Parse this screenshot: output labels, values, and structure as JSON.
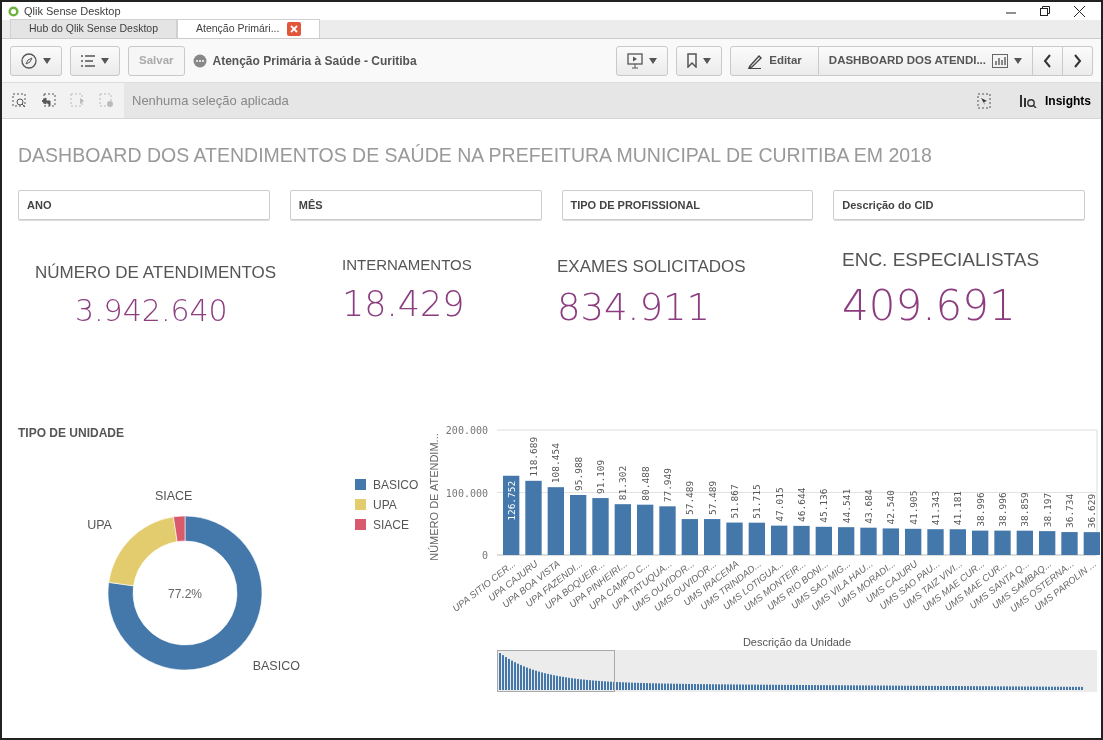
{
  "window": {
    "title": "Qlik Sense Desktop"
  },
  "tabs": [
    {
      "label": "Hub do Qlik Sense Desktop",
      "selected": false,
      "closable": false
    },
    {
      "label": "Atenção Primári...",
      "selected": true,
      "closable": true
    }
  ],
  "toolbar": {
    "save_label": "Salvar",
    "save_disabled": true,
    "app_title": "Atenção Primária à Saúde - Curitiba",
    "edit_label": "Editar",
    "sheet_label": "DASHBOARD DOS ATENDI..."
  },
  "selection_bar": {
    "message": "Nenhuma seleção aplicada",
    "insights_label": "Insights"
  },
  "dashboard": {
    "title": "DASHBOARD DOS ATENDIMENTOS DE SAÚDE NA PREFEITURA MUNICIPAL DE CURITIBA EM 2018",
    "filters": [
      "ANO",
      "MÊS",
      "TIPO DE PROFISSIONAL",
      "Descrição do CID"
    ],
    "kpis": [
      {
        "label": "NÚMERO DE ATENDIMENTOS",
        "value": "3.942.640"
      },
      {
        "label": "INTERNAMENTOS",
        "value": "18.429"
      },
      {
        "label": "EXAMES SOLICITADOS",
        "value": "834.911"
      },
      {
        "label": "ENC. ESPECIALISTAS",
        "value": "409.691"
      }
    ]
  },
  "donut": {
    "center_label": "77.2%",
    "chart_data": {
      "type": "donut",
      "title": "TIPO DE UNIDADE",
      "categories": [
        "BASICO",
        "UPA",
        "SIACE"
      ],
      "legend": "right",
      "series": [
        {
          "colors": [
            "#4477aa",
            "#e3cc6e",
            "#d9596d"
          ],
          "values": [
            77.2,
            20.4,
            2.4
          ]
        }
      ]
    }
  },
  "bar_chart": {
    "chart_data": {
      "type": "bar",
      "ylabel": "NÚMERO DE ATENDIM...",
      "xlabel": "Descrição da Unidade",
      "ylim": [
        0,
        200
      ],
      "yticks": [
        0,
        {
          "value": 100,
          "label": "100.000"
        },
        {
          "value": 200,
          "label": "200.000"
        }
      ],
      "value_labels": [
        "126.752",
        "118.689",
        "108.454",
        "95.988",
        "91.109",
        "81.302",
        "80.488",
        "77.949",
        "57.489",
        "57.489",
        "51.867",
        "51.715",
        "47.015",
        "46.644",
        "45.136",
        "44.541",
        "43.684",
        "42.540",
        "41.905",
        "41.343",
        "41.181",
        "38.996",
        "38.996",
        "38.859",
        "38.197",
        "36.734",
        "36.629"
      ],
      "categories": [
        "UPA SITIO CER...",
        "UPA CAJURU",
        "UPA BOA VISTA",
        "UPA FAZENDI...",
        "UPA BOQUEIR...",
        "UPA PINHEIRI...",
        "UPA CAMPO C...",
        "UPA TATUQUA...",
        "UMS OUVIDOR...",
        "UMS OUVIDOR...",
        "UMS IRACEMA",
        "UMS TRINDAD...",
        "UMS LOTIGUA...",
        "UMS MONTEIR...",
        "UMS RIO BONI...",
        "UMS SAO MIG...",
        "UMS VILA HAU...",
        "UMS MORADI...",
        "UMS CAJURU",
        "UMS SAO PAU...",
        "UMS TAIZ VIVI...",
        "UMS MAE CUR...",
        "UMS MAE CUR...",
        "UMS SANTA Q...",
        "UMS SAMBAQ...",
        "UMS OSTERNA...",
        "UMS PAROLIN ..."
      ],
      "series": [
        {
          "color": "#4477aa",
          "values": [
            126.8,
            118.7,
            108.5,
            96.0,
            91.1,
            81.3,
            80.5,
            77.9,
            57.5,
            57.5,
            51.9,
            51.7,
            47.0,
            46.6,
            45.1,
            44.5,
            43.7,
            42.5,
            41.9,
            41.3,
            41.2,
            39.0,
            39.0,
            38.9,
            38.2,
            36.7,
            36.6
          ]
        }
      ]
    }
  }
}
